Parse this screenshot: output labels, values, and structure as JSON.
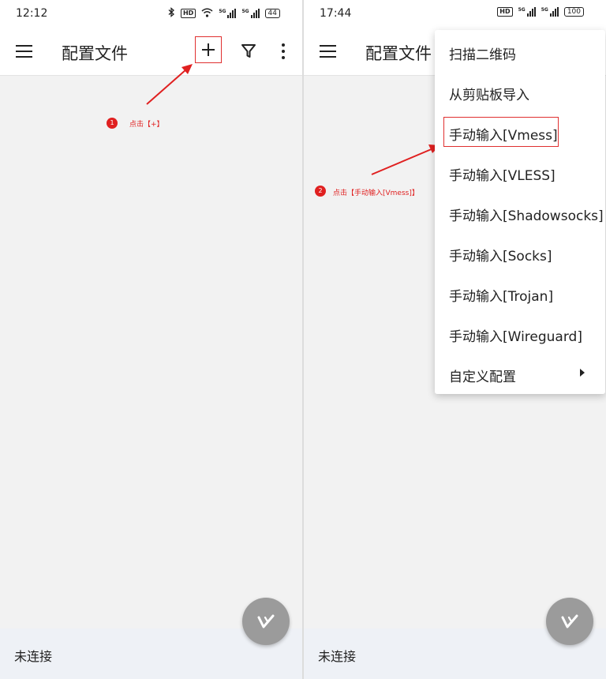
{
  "left_screen": {
    "status_time": "12:12",
    "battery": "44",
    "app_title": "配置文件",
    "bottom_status": "未连接",
    "annotation_number": "1",
    "annotation_text": "点击【+】"
  },
  "right_screen": {
    "status_time": "17:44",
    "battery": "100",
    "app_title": "配置文件",
    "bottom_status": "未连接",
    "annotation_number": "2",
    "annotation_text": "点击【手动输入[Vmess]】",
    "menu_items": [
      "扫描二维码",
      "从剪贴板导入",
      "手动输入[Vmess]",
      "手动输入[VLESS]",
      "手动输入[Shadowsocks]",
      "手动输入[Socks]",
      "手动输入[Trojan]",
      "手动输入[Wireguard]",
      "自定义配置"
    ]
  },
  "status_icons": {
    "hd_label": "HD",
    "signal_label": "5G"
  },
  "colors": {
    "annotation": "#e02020",
    "fab": "#9b9b9b",
    "bottom_bar": "#eef1f6"
  },
  "icons": [
    "menu-icon",
    "plus-icon",
    "filter-icon",
    "more-vert-icon",
    "bluetooth-icon",
    "wifi-icon",
    "signal-icon",
    "battery-icon",
    "v-logo-icon",
    "submenu-arrow-icon"
  ]
}
